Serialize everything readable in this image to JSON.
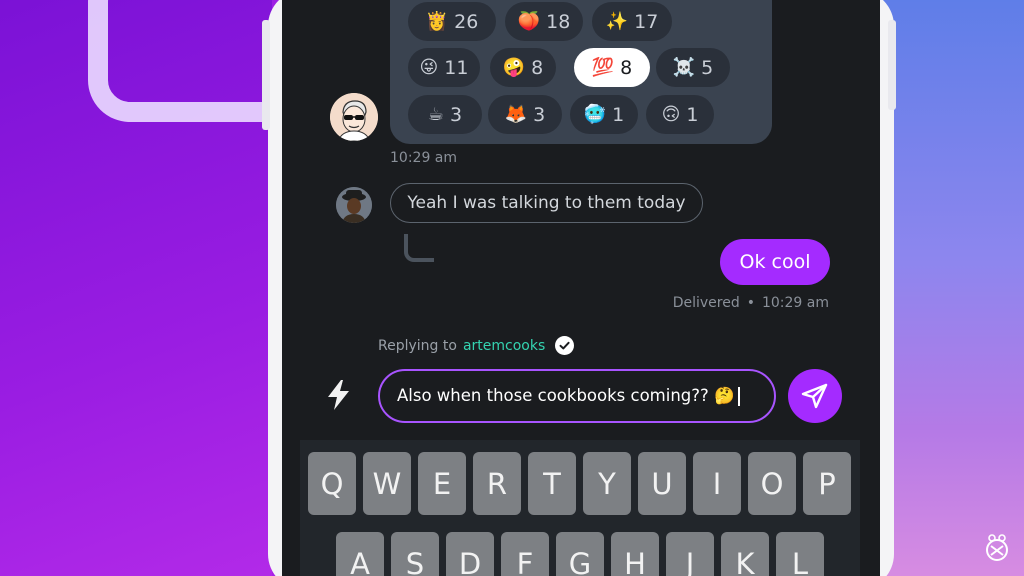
{
  "colors": {
    "accent": "#a42bff",
    "screen_bg": "#1a1c1f",
    "reaction_panel": "#3a4350",
    "reply_user": "#34d3b0"
  },
  "reactions": [
    {
      "emoji": "👸",
      "count": "26",
      "active": false
    },
    {
      "emoji": "🍑",
      "count": "18",
      "active": false
    },
    {
      "emoji": "✨",
      "count": "17",
      "active": false
    },
    {
      "emoji": "😜",
      "count": "11",
      "active": false
    },
    {
      "emoji": "🤪",
      "count": "8",
      "active": false
    },
    {
      "emoji": "💯",
      "count": "8",
      "active": true
    },
    {
      "emoji": "☠️",
      "count": "5",
      "active": false
    },
    {
      "emoji": "☕",
      "count": "3",
      "active": false
    },
    {
      "emoji": "🦊",
      "count": "3",
      "active": false
    },
    {
      "emoji": "🥶",
      "count": "1",
      "active": false
    },
    {
      "emoji": "🙃",
      "count": "1",
      "active": false
    }
  ],
  "messages": {
    "reactions_timestamp": "10:29 am",
    "incoming_text": "Yeah I was talking to them today",
    "outgoing_text": "Ok cool",
    "delivery_status": "Delivered",
    "delivery_separator": "•",
    "delivery_time": "10:29 am"
  },
  "composer": {
    "replying_prefix": "Replying to",
    "replying_user": "artemcooks",
    "input_text": "Also when those cookbooks coming?? 🤔",
    "quick_icon": "bolt-icon",
    "send_icon": "send-icon"
  },
  "keyboard": {
    "row1": [
      "Q",
      "W",
      "E",
      "R",
      "T",
      "Y",
      "U",
      "I",
      "O",
      "P"
    ],
    "row2": [
      "A",
      "S",
      "D",
      "F",
      "G",
      "H",
      "J",
      "K",
      "L"
    ]
  }
}
